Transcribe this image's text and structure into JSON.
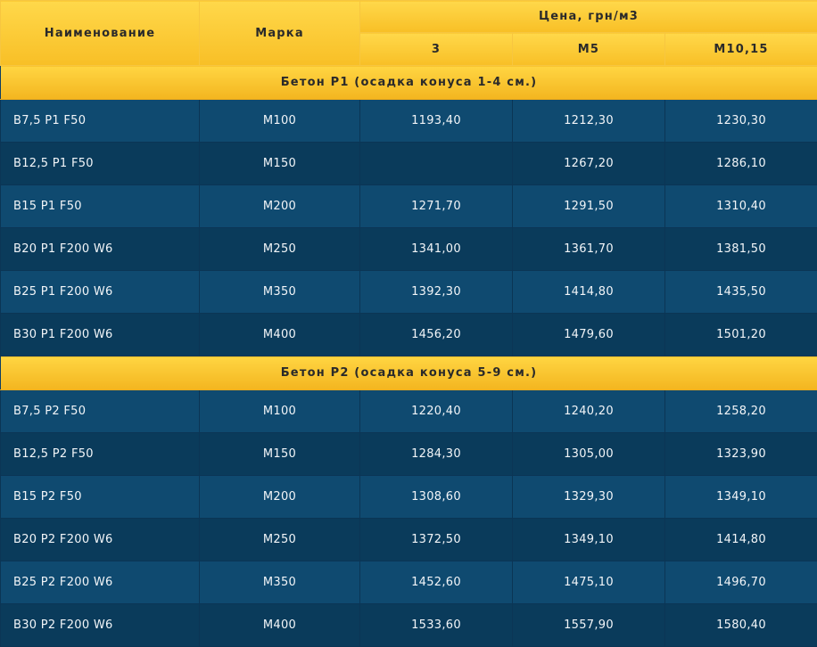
{
  "header": {
    "name": "Наименование",
    "grade": "Марка",
    "price": "Цена, грн/м3",
    "sub": [
      "3",
      "М5",
      "М10,15"
    ]
  },
  "groups": [
    {
      "title": "Бетон Р1 (осадка конуса 1-4 см.)",
      "rows": [
        {
          "name": "B7,5 P1 F50",
          "grade": "M100",
          "p3": "1193,40",
          "m5": "1212,30",
          "m10": "1230,30"
        },
        {
          "name": "B12,5 P1 F50",
          "grade": "M150",
          "p3": "",
          "m5": "1267,20",
          "m10": "1286,10"
        },
        {
          "name": "B15 P1 F50",
          "grade": "M200",
          "p3": "1271,70",
          "m5": "1291,50",
          "m10": "1310,40"
        },
        {
          "name": "B20 P1 F200 W6",
          "grade": "M250",
          "p3": "1341,00",
          "m5": "1361,70",
          "m10": "1381,50"
        },
        {
          "name": "B25 P1 F200 W6",
          "grade": "M350",
          "p3": "1392,30",
          "m5": "1414,80",
          "m10": "1435,50"
        },
        {
          "name": "B30 P1 F200 W6",
          "grade": "M400",
          "p3": "1456,20",
          "m5": "1479,60",
          "m10": "1501,20"
        }
      ]
    },
    {
      "title": "Бетон Р2 (осадка конуса 5-9 см.)",
      "rows": [
        {
          "name": "B7,5 P2 F50",
          "grade": "M100",
          "p3": "1220,40",
          "m5": "1240,20",
          "m10": "1258,20"
        },
        {
          "name": "B12,5 P2 F50",
          "grade": "M150",
          "p3": "1284,30",
          "m5": "1305,00",
          "m10": "1323,90"
        },
        {
          "name": "B15 P2 F50",
          "grade": "M200",
          "p3": "1308,60",
          "m5": "1329,30",
          "m10": "1349,10"
        },
        {
          "name": "B20 P2 F200 W6",
          "grade": "M250",
          "p3": "1372,50",
          "m5": "1349,10",
          "m10": "1414,80"
        },
        {
          "name": "B25 P2 F200 W6",
          "grade": "M350",
          "p3": "1452,60",
          "m5": "1475,10",
          "m10": "1496,70"
        },
        {
          "name": "B30 P2 F200 W6",
          "grade": "M400",
          "p3": "1533,60",
          "m5": "1557,90",
          "m10": "1580,40"
        }
      ]
    }
  ]
}
